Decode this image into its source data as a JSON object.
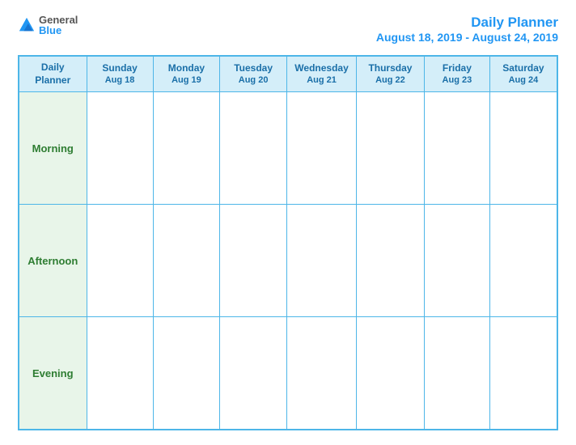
{
  "header": {
    "logo": {
      "general": "General",
      "blue": "Blue",
      "icon_shape": "triangle"
    },
    "title": "Daily Planner",
    "date_range": "August 18, 2019 - August 24, 2019"
  },
  "table": {
    "col_header_label": "Daily\nPlanner",
    "days": [
      {
        "name": "Sunday",
        "date": "Aug 18"
      },
      {
        "name": "Monday",
        "date": "Aug 19"
      },
      {
        "name": "Tuesday",
        "date": "Aug 20"
      },
      {
        "name": "Wednesday",
        "date": "Aug 21"
      },
      {
        "name": "Thursday",
        "date": "Aug 22"
      },
      {
        "name": "Friday",
        "date": "Aug 23"
      },
      {
        "name": "Saturday",
        "date": "Aug 24"
      }
    ],
    "rows": [
      {
        "label": "Morning"
      },
      {
        "label": "Afternoon"
      },
      {
        "label": "Evening"
      }
    ]
  }
}
